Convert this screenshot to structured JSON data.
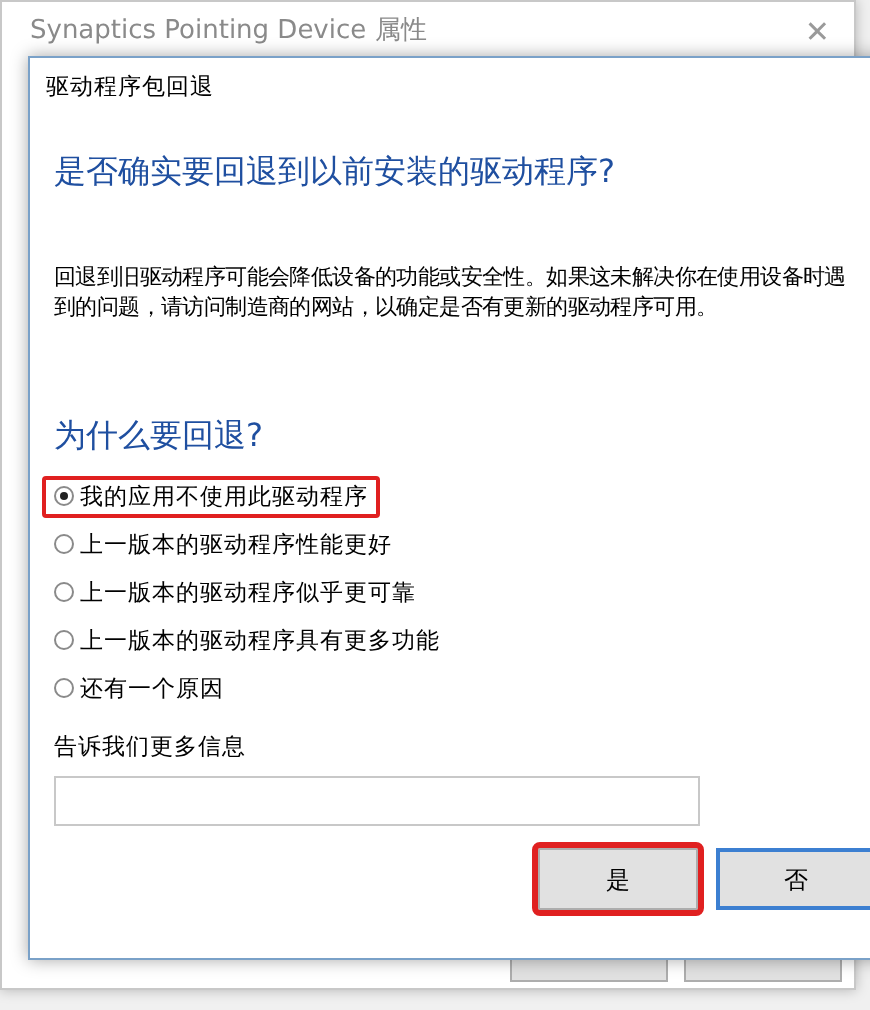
{
  "background_window": {
    "title": "Synaptics Pointing Device 属性",
    "close": "✕"
  },
  "dialog": {
    "title": "驱动程序包回退",
    "question": "是否确实要回退到以前安装的驱动程序?",
    "description": "回退到旧驱动程序可能会降低设备的功能或安全性。如果这未解决你在使用设备时遇到的问题，请访问制造商的网站，以确定是否有更新的驱动程序可用。",
    "reason_heading": "为什么要回退?",
    "reasons": [
      {
        "label": "我的应用不使用此驱动程序",
        "selected": true,
        "highlighted": true
      },
      {
        "label": "上一版本的驱动程序性能更好",
        "selected": false,
        "highlighted": false
      },
      {
        "label": "上一版本的驱动程序似乎更可靠",
        "selected": false,
        "highlighted": false
      },
      {
        "label": "上一版本的驱动程序具有更多功能",
        "selected": false,
        "highlighted": false
      },
      {
        "label": "还有一个原因",
        "selected": false,
        "highlighted": false
      }
    ],
    "more_info_label": "告诉我们更多信息",
    "buttons": [
      {
        "label": "是",
        "highlighted": true
      },
      {
        "label": "否",
        "highlighted": false
      }
    ]
  }
}
